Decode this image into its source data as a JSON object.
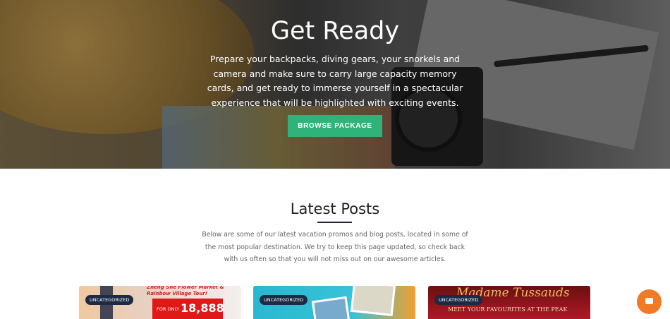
{
  "hero": {
    "title": "Get Ready",
    "text": "Prepare your backpacks, diving gears, your snorkels and camera and make sure to carry large capacity memory cards, and get ready to immerse yourself in a spectacular experience that will be highlighted with exciting events.",
    "button": "BROWSE PACKAGE"
  },
  "latest": {
    "title": "Latest Posts",
    "description": "Below are some of our latest vacation promos and blog posts, located in some of the most popular destination. We try to keep this page updated, so check back with us often so that you will not miss out on our awesome articles."
  },
  "cards": [
    {
      "badge": "UNCATEGORIZED",
      "image_text": "Zheng She Flower Market & Rainbow Village Tour!",
      "price_label": "FOR ONLY",
      "price": "18,888"
    },
    {
      "badge": "UNCATEGORIZED"
    },
    {
      "badge": "UNCATEGORIZED",
      "image_text": "Madame Tussauds",
      "subtitle": "MEET YOUR FAVOURITES AT THE PEAK"
    }
  ],
  "colors": {
    "button": "#2fb37a",
    "badge": "#1d2a44",
    "chat": "#f07a25"
  }
}
